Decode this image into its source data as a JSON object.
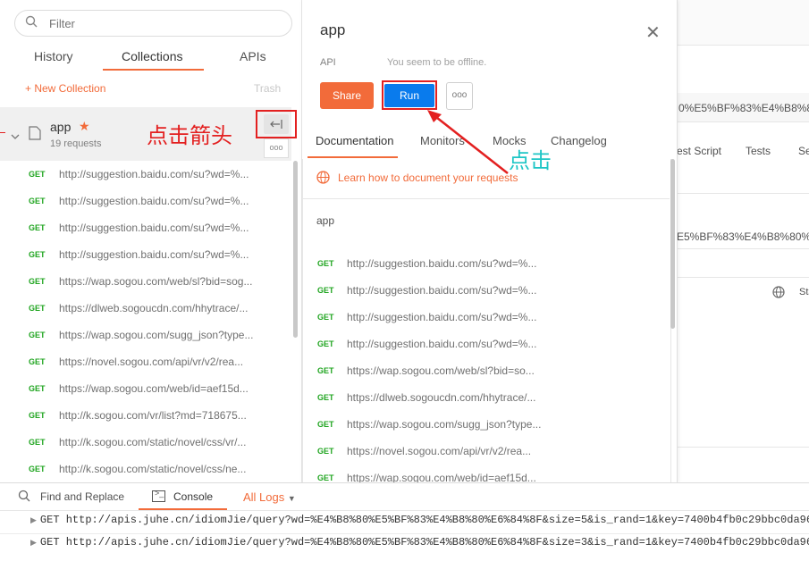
{
  "sidebar": {
    "search_placeholder": "Filter",
    "tabs": [
      "History",
      "Collections",
      "APIs"
    ],
    "new_collection": "+ New Collection",
    "trash": "Trash",
    "collection": {
      "name": "app",
      "count": "19 requests"
    },
    "requests": [
      {
        "method": "GET",
        "url": "http://suggestion.baidu.com/su?wd=%..."
      },
      {
        "method": "GET",
        "url": "http://suggestion.baidu.com/su?wd=%..."
      },
      {
        "method": "GET",
        "url": "http://suggestion.baidu.com/su?wd=%..."
      },
      {
        "method": "GET",
        "url": "http://suggestion.baidu.com/su?wd=%..."
      },
      {
        "method": "GET",
        "url": "https://wap.sogou.com/web/sl?bid=sog..."
      },
      {
        "method": "GET",
        "url": "https://dlweb.sogoucdn.com/hhytrace/..."
      },
      {
        "method": "GET",
        "url": "https://wap.sogou.com/sugg_json?type..."
      },
      {
        "method": "GET",
        "url": "https://novel.sogou.com/api/vr/v2/rea..."
      },
      {
        "method": "GET",
        "url": "https://wap.sogou.com/web/id=aef15d..."
      },
      {
        "method": "GET",
        "url": "http://k.sogou.com/vr/list?md=718675..."
      },
      {
        "method": "GET",
        "url": "http://k.sogou.com/static/novel/css/vr/..."
      },
      {
        "method": "GET",
        "url": "http://k.sogou.com/static/novel/css/ne..."
      }
    ]
  },
  "panel": {
    "title": "app",
    "close": "✕",
    "api_label": "API",
    "offline": "You seem to be offline.",
    "share": "Share",
    "run": "Run",
    "more": "ooo",
    "tabs": [
      "Documentation",
      "Monitors",
      "Mocks",
      "Changelog"
    ],
    "learn_link": "Learn how to document your requests",
    "description": "app",
    "requests": [
      {
        "method": "GET",
        "url": "http://suggestion.baidu.com/su?wd=%..."
      },
      {
        "method": "GET",
        "url": "http://suggestion.baidu.com/su?wd=%..."
      },
      {
        "method": "GET",
        "url": "http://suggestion.baidu.com/su?wd=%..."
      },
      {
        "method": "GET",
        "url": "http://suggestion.baidu.com/su?wd=%..."
      },
      {
        "method": "GET",
        "url": "https://wap.sogou.com/web/sl?bid=so..."
      },
      {
        "method": "GET",
        "url": "https://dlweb.sogoucdn.com/hhytrace/..."
      },
      {
        "method": "GET",
        "url": "https://wap.sogou.com/sugg_json?type..."
      },
      {
        "method": "GET",
        "url": "https://novel.sogou.com/api/vr/v2/rea..."
      },
      {
        "method": "GET",
        "url": "https://wap.sogou.com/web/id=aef15d..."
      }
    ]
  },
  "background": {
    "url_fragment_1": "0%E5%BF%83%E4%B8%80",
    "tabs": [
      "est Script",
      "Tests",
      "Se"
    ],
    "url_fragment_2": "E5%BF%83%E4%B8%80%E",
    "sta": "Sta"
  },
  "console": {
    "find_replace": "Find and Replace",
    "console_tab": "Console",
    "all_logs": "All Logs",
    "lines": [
      "GET http://apis.juhe.cn/idiomJie/query?wd=%E4%B8%80%E5%BF%83%E4%B8%80%E6%84%8F&size=5&is_rand=1&key=7400b4fb0c29bbc0da96",
      "GET http://apis.juhe.cn/idiomJie/query?wd=%E4%B8%80%E5%BF%83%E4%B8%80%E6%84%8F&size=3&is_rand=1&key=7400b4fb0c29bbc0da96"
    ]
  },
  "annotations": {
    "click_arrow": "点击箭头",
    "click": "点击"
  },
  "colors": {
    "accent": "#f26b3a",
    "run_blue": "#097bed",
    "get_green": "#20a520",
    "annot_red": "#e32020",
    "annot_cyan": "#1ec6c6"
  }
}
